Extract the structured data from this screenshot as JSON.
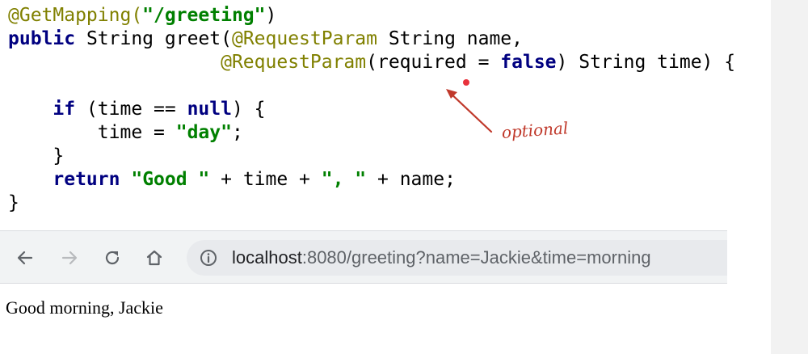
{
  "code": {
    "lines": [
      [
        {
          "t": "@GetMapping(",
          "c": "annotation"
        },
        {
          "t": "\"/greeting\"",
          "c": "string"
        },
        {
          "t": ")",
          "c": "plain"
        }
      ],
      [
        {
          "t": "public",
          "c": "keyword"
        },
        {
          "t": " String greet(",
          "c": "plain"
        },
        {
          "t": "@RequestParam",
          "c": "annotation"
        },
        {
          "t": " String name,",
          "c": "plain"
        }
      ],
      [
        {
          "t": "                   ",
          "c": "plain"
        },
        {
          "t": "@RequestParam",
          "c": "annotation"
        },
        {
          "t": "(required = ",
          "c": "plain"
        },
        {
          "t": "false",
          "c": "keyword"
        },
        {
          "t": ") String time) {",
          "c": "plain"
        }
      ],
      [],
      [
        {
          "t": "    ",
          "c": "plain"
        },
        {
          "t": "if",
          "c": "keyword"
        },
        {
          "t": " (time == ",
          "c": "plain"
        },
        {
          "t": "null",
          "c": "keyword"
        },
        {
          "t": ") {",
          "c": "plain"
        }
      ],
      [
        {
          "t": "        time = ",
          "c": "plain"
        },
        {
          "t": "\"day\"",
          "c": "string"
        },
        {
          "t": ";",
          "c": "plain"
        }
      ],
      [
        {
          "t": "    }",
          "c": "plain"
        }
      ],
      [
        {
          "t": "    ",
          "c": "plain"
        },
        {
          "t": "return",
          "c": "keyword"
        },
        {
          "t": " ",
          "c": "plain"
        },
        {
          "t": "\"Good \"",
          "c": "string"
        },
        {
          "t": " + time + ",
          "c": "plain"
        },
        {
          "t": "\", \"",
          "c": "string"
        },
        {
          "t": " + name;",
          "c": "plain"
        }
      ],
      [
        {
          "t": "}",
          "c": "plain"
        }
      ]
    ]
  },
  "callout": {
    "label": "optional",
    "color": "#c0392b"
  },
  "browser": {
    "nav": {
      "back_icon": "arrow-left-icon",
      "forward_icon": "arrow-right-icon",
      "reload_icon": "reload-icon",
      "home_icon": "home-icon"
    },
    "address": {
      "host": "localhost",
      "rest": ":8080/greeting?name=Jackie&time=morning",
      "info_icon": "info-icon"
    },
    "page_text": "Good morning, Jackie"
  },
  "colors": {
    "annotation": "#808000",
    "keyword": "#000080",
    "string": "#008000",
    "toolbar_bg": "#f1f3f4",
    "omnibox_bg": "#e8eaed"
  }
}
